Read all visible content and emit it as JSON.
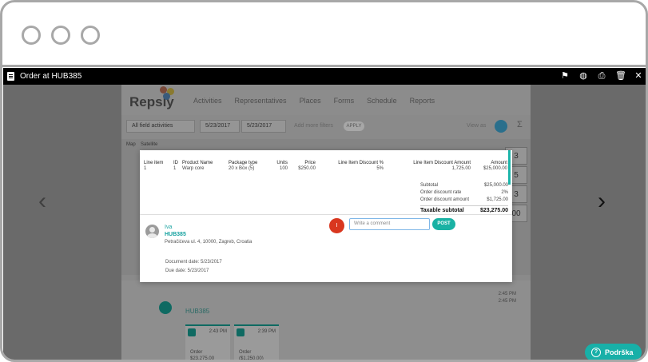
{
  "viewer": {
    "title": "Order at HUB385",
    "tools": [
      {
        "icon": "flag-icon",
        "glyph": "⚑"
      },
      {
        "icon": "globe-icon",
        "glyph": "◍"
      },
      {
        "icon": "print-icon",
        "glyph": "⎙"
      },
      {
        "icon": "trash-icon",
        "glyph": "🗑"
      },
      {
        "icon": "close-icon",
        "glyph": "✕"
      }
    ],
    "prev_glyph": "‹",
    "next_glyph": "›"
  },
  "background_app": {
    "logo": "Repsly",
    "nav": [
      "Activities",
      "Representatives",
      "Places",
      "Forms",
      "Schedule",
      "Reports"
    ],
    "filters": {
      "activity_filter": "All field activities",
      "date_from": "5/23/2017",
      "date_to": "5/23/2017",
      "more_filters": "Add more filters",
      "apply": "APPLY",
      "view_as": "View as"
    },
    "map_tabs": [
      "Map",
      "Satellite"
    ],
    "side_counts": [
      "3",
      "5",
      "3",
      "00"
    ],
    "lower": {
      "hub": "HUB385",
      "times_right": [
        "2:45 PM",
        "2:45 PM"
      ],
      "tiles": [
        {
          "time": "2:43 PM",
          "label": "Order",
          "value": "$23,275.00"
        },
        {
          "time": "2:39 PM",
          "label": "Order",
          "value": "($1,250.00)"
        }
      ]
    }
  },
  "order": {
    "columns": [
      "Line item",
      "ID",
      "Product Name",
      "Package type",
      "Units",
      "Price",
      "Line Item Discount %",
      "Line Item Discount Amount",
      "Amount"
    ],
    "rows": [
      [
        "1",
        "1",
        "Warp core",
        "20 x Box (5)",
        "100",
        "$250.00",
        "5%",
        "1,725.00",
        "$25,000.00"
      ]
    ],
    "totals": [
      {
        "label": "Subtotal",
        "value": "$25,000.00"
      },
      {
        "label": "Order discount rate",
        "value": "2%"
      },
      {
        "label": "Order discount amount",
        "value": "$1,725.00"
      }
    ],
    "grand_total": {
      "label": "Taxable subtotal",
      "value": "$23,275.00"
    },
    "representative": "Iva",
    "place": "HUB385",
    "address": "Petračićeva ul. 4, 10000, Zagreb, Croatia",
    "document_date": "Document date: 5/23/2017",
    "due_date": "Due date: 5/23/2017"
  },
  "comment": {
    "avatar_initial": "I",
    "placeholder": "Write a comment",
    "post_label": "POST"
  },
  "help": {
    "label": "Podrška"
  },
  "colors": {
    "accent": "#1ab2a4",
    "comment_avatar": "#d9371f"
  }
}
